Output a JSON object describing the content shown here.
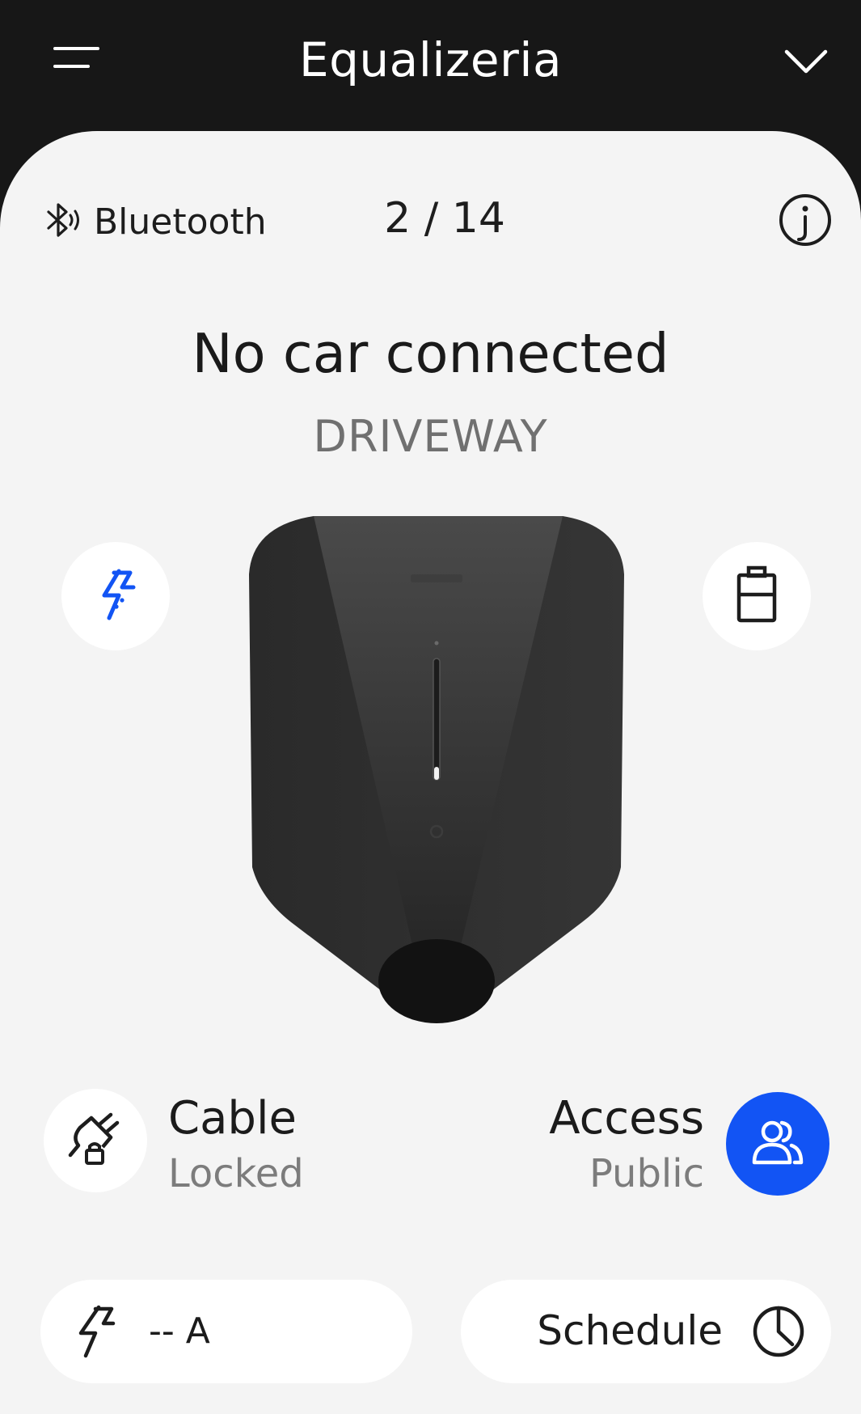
{
  "header": {
    "title": "Equalizeria",
    "menu_icon": "hamburger-menu-icon",
    "dropdown_icon": "chevron-down-icon"
  },
  "connection": {
    "type_label": "Bluetooth",
    "icon": "bluetooth-icon",
    "counter": "2 / 14",
    "info_icon": "info-icon"
  },
  "status": {
    "title": "No car connected",
    "location": "DRIVEWAY"
  },
  "side_buttons": {
    "left_icon": "smart-charging-bolt-icon",
    "right_icon": "battery-icon"
  },
  "cable": {
    "label": "Cable",
    "value": "Locked",
    "icon": "plug-lock-icon"
  },
  "access": {
    "label": "Access",
    "value": "Public",
    "icon": "users-icon"
  },
  "bottom": {
    "current_text": "-- A",
    "current_icon": "bolt-icon",
    "schedule_text": "Schedule",
    "schedule_icon": "clock-icon"
  },
  "colors": {
    "header_bg": "#171717",
    "card_bg": "#f4f4f4",
    "accent_blue": "#1254f4",
    "muted_text": "#707070"
  }
}
